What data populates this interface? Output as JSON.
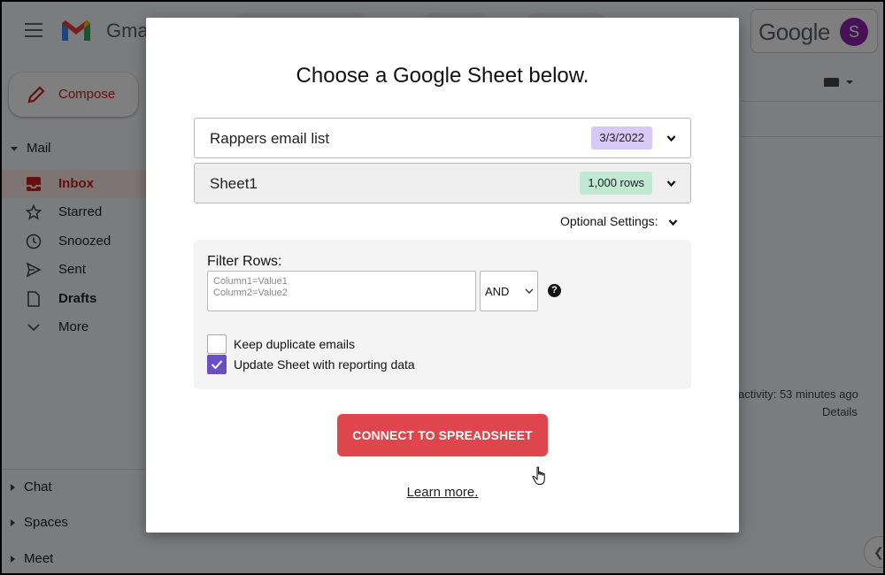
{
  "gmail": {
    "app_name": "Gma",
    "google_word": "Google",
    "avatar_initial": "S",
    "compose_label": "Compose",
    "mail_section": "Mail",
    "nav": [
      {
        "label": "Inbox",
        "icon": "inbox-icon",
        "active": true
      },
      {
        "label": "Starred",
        "icon": "star-icon"
      },
      {
        "label": "Snoozed",
        "icon": "clock-icon"
      },
      {
        "label": "Sent",
        "icon": "send-icon"
      },
      {
        "label": "Drafts",
        "icon": "file-icon",
        "bold": true
      },
      {
        "label": "More",
        "icon": "chevron-down-icon"
      }
    ],
    "bottom_sections": [
      "Chat",
      "Spaces",
      "Meet"
    ],
    "activity_text": "activity: 53 minutes ago",
    "details_link": "Details"
  },
  "modal": {
    "title": "Choose a Google Sheet below.",
    "spreadsheet": {
      "name": "Rappers email list",
      "date": "3/3/2022"
    },
    "sheet": {
      "name": "Sheet1",
      "rows": "1,000 rows"
    },
    "optional_settings": "Optional Settings:",
    "filter": {
      "label": "Filter Rows:",
      "placeholder": "Column1=Value1\nColumn2=Value2",
      "operator": "AND",
      "help": "?"
    },
    "options": [
      {
        "label": "Keep duplicate emails",
        "checked": false
      },
      {
        "label": "Update Sheet with reporting data",
        "checked": true
      }
    ],
    "connect_button": "CONNECT TO SPREADSHEET",
    "learn_more": "Learn more."
  },
  "colors": {
    "accent_red": "#df454c",
    "check_purple": "#6a4fc4",
    "date_badge": "#d6c9f5",
    "rows_badge": "#bfe9d3",
    "gmail_red": "#c5221f"
  }
}
